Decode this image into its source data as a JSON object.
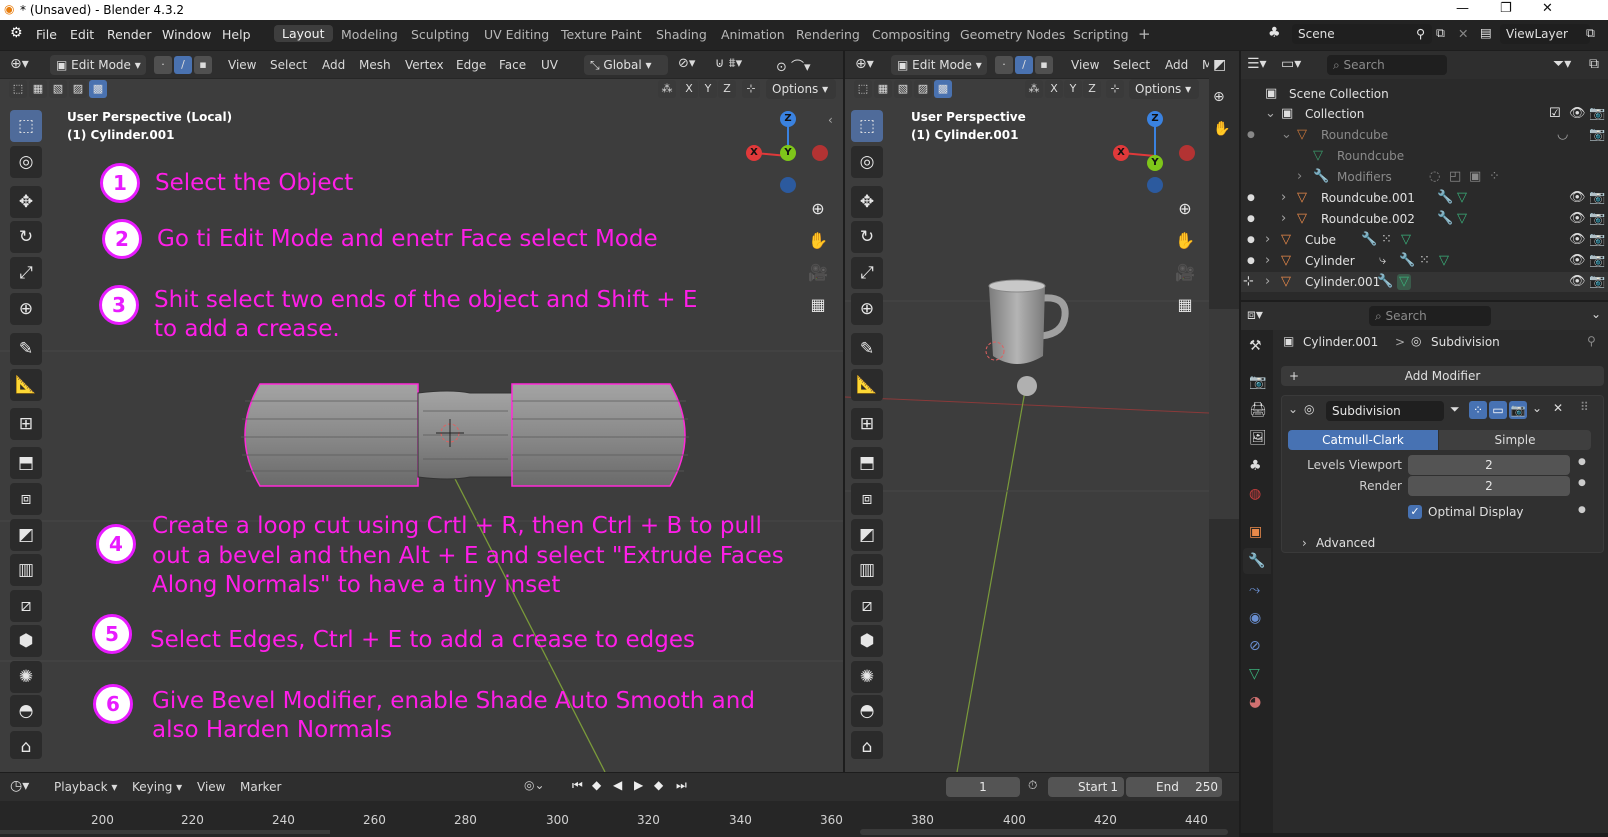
{
  "titlebar": {
    "title": "* (Unsaved) - Blender 4.3.2",
    "minimize": "—",
    "maximize": "❐",
    "close": "✕"
  },
  "menu": {
    "items": [
      "File",
      "Edit",
      "Render",
      "Window",
      "Help"
    ]
  },
  "workspaces": {
    "tabs": [
      "Layout",
      "Modeling",
      "Sculpting",
      "UV Editing",
      "Texture Paint",
      "Shading",
      "Animation",
      "Rendering",
      "Compositing",
      "Geometry Nodes",
      "Scripting"
    ],
    "add": "+"
  },
  "scene": {
    "name": "Scene",
    "view_layer": "ViewLayer"
  },
  "left_viewport": {
    "mode": "Edit Mode",
    "menus": [
      "View",
      "Select",
      "Add",
      "Mesh",
      "Vertex",
      "Edge",
      "Face",
      "UV"
    ],
    "transform": "Global",
    "xyz": [
      "X",
      "Y",
      "Z"
    ],
    "options": "Options",
    "overlay_title": "User Perspective (Local)",
    "overlay_object": "(1) Cylinder.001"
  },
  "right_viewport": {
    "mode": "Edit Mode",
    "menus": [
      "View",
      "Select",
      "Add",
      "M"
    ],
    "xyz": [
      "X",
      "Y",
      "Z"
    ],
    "options": "Options",
    "overlay_title": "User Perspective",
    "overlay_object": "(1) Cylinder.001"
  },
  "gizmo": {
    "x": "X",
    "y": "Y",
    "z": "Z",
    "colors": {
      "x": "#e0393a",
      "y": "#7ec61a",
      "z": "#3a82e0"
    }
  },
  "instructions": [
    {
      "num": "1",
      "lines": [
        "Select the Object"
      ]
    },
    {
      "num": "2",
      "lines": [
        "Go ti Edit Mode and enetr Face select Mode"
      ]
    },
    {
      "num": "3",
      "lines": [
        "Shit select two ends of  the object  and Shift + E",
        "to add a crease."
      ]
    },
    {
      "num": "4",
      "lines": [
        "Create a loop cut using Crtl + R, then Ctrl + B to pull",
        "out a bevel and then Alt + E and select \"Extrude Faces",
        "Along Normals\" to have a tiny inset"
      ]
    },
    {
      "num": "5",
      "lines": [
        "Select Edges, Ctrl + E to add a crease to edges"
      ]
    },
    {
      "num": "6",
      "lines": [
        "Give Bevel Modifier, enable Shade Auto Smooth and",
        "also Harden Normals"
      ]
    }
  ],
  "instruction_color": "#ff1ee8",
  "outliner": {
    "search_placeholder": "Search",
    "scene_collection": "Scene Collection",
    "collection": "Collection",
    "items": [
      {
        "name": "Roundcube",
        "dim": true
      },
      {
        "name": "Roundcube",
        "dim": true
      },
      {
        "name": "Modifiers",
        "dim": true
      },
      {
        "name": "Roundcube.001",
        "dim": false
      },
      {
        "name": "Roundcube.002",
        "dim": false
      },
      {
        "name": "Cube",
        "dim": false
      },
      {
        "name": "Cylinder",
        "dim": false
      },
      {
        "name": "Cylinder.001",
        "dim": false
      }
    ]
  },
  "properties": {
    "search_placeholder": "Search",
    "breadcrumb_object": "Cylinder.001",
    "breadcrumb_sep": ">",
    "breadcrumb_modifier": "Subdivision",
    "add_modifier": "Add Modifier",
    "modifier_name": "Subdivision",
    "catmull_clark": "Catmull-Clark",
    "simple": "Simple",
    "levels_viewport_label": "Levels Viewport",
    "levels_viewport_value": "2",
    "render_label": "Render",
    "render_value": "2",
    "optimal_display": "Optimal Display",
    "optimal_checked": true,
    "advanced": "Advanced",
    "accent": "#4772b3"
  },
  "timeline": {
    "menus": [
      "Playback",
      "Keying",
      "View",
      "Marker"
    ],
    "current_frame": "1",
    "start_label": "Start",
    "start": "1",
    "end_label": "End",
    "end": "250",
    "ticks": [
      "200",
      "220",
      "240",
      "260",
      "280",
      "300",
      "320",
      "340",
      "360",
      "380",
      "400",
      "420",
      "440"
    ]
  }
}
